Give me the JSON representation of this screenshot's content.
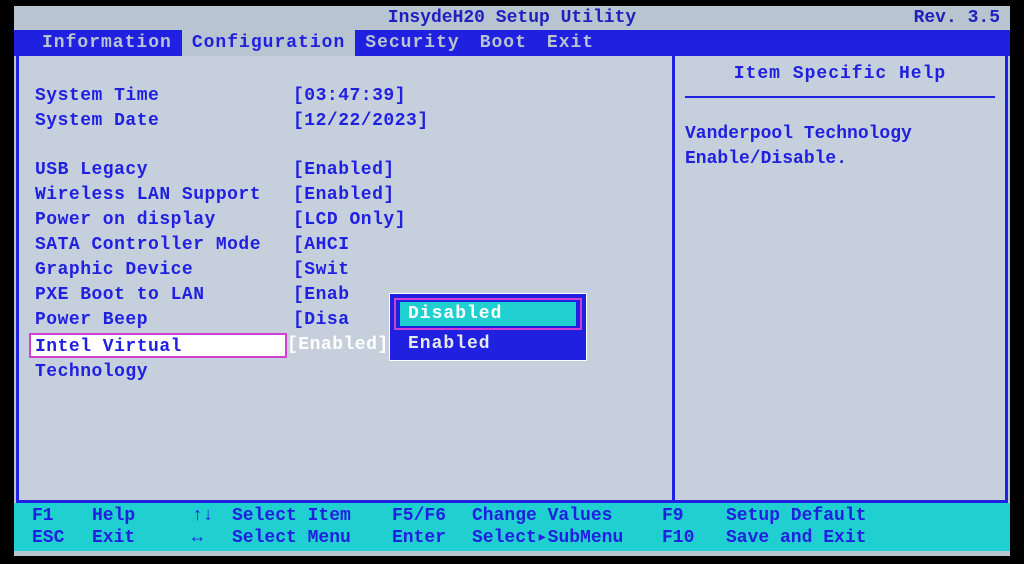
{
  "title": "InsydeH20 Setup Utility",
  "revision": "Rev. 3.5",
  "menu": {
    "items": [
      "Information",
      "Configuration",
      "Security",
      "Boot",
      "Exit"
    ],
    "active_index": 1
  },
  "settings": [
    {
      "label": "System Time",
      "value": "[03:47:39]"
    },
    {
      "label": "System Date",
      "value": "[12/22/2023]"
    }
  ],
  "settings2": [
    {
      "label": "USB Legacy",
      "value": "[Enabled]"
    },
    {
      "label": "Wireless LAN Support",
      "value": "[Enabled]"
    },
    {
      "label": "Power on display",
      "value": "[LCD Only]"
    },
    {
      "label": "SATA Controller Mode",
      "value": "[AHCI"
    },
    {
      "label": "Graphic Device",
      "value": "[Swit"
    },
    {
      "label": "PXE Boot to LAN",
      "value": "[Enab"
    },
    {
      "label": "Power Beep",
      "value": "[Disa"
    },
    {
      "label": "Intel Virtual Technology",
      "value": "[Enabled]",
      "selected": true
    }
  ],
  "popup": {
    "options": [
      "Disabled",
      "Enabled"
    ],
    "selected_index": 0
  },
  "help": {
    "title": "Item Specific Help",
    "text": "Vanderpool Technology Enable/Disable."
  },
  "footer": {
    "row1": [
      {
        "key": "F1",
        "label": "Help",
        "arrow": "↑↓",
        "desc": "Select Item"
      },
      {
        "key": "F5/F6",
        "desc": "Change Values"
      },
      {
        "key": "F9",
        "desc": "Setup Default"
      }
    ],
    "row2": [
      {
        "key": "ESC",
        "label": "Exit",
        "arrow": "↔",
        "desc": "Select Menu"
      },
      {
        "key": "Enter",
        "desc": "Select▸SubMenu"
      },
      {
        "key": "F10",
        "desc": "Save and Exit"
      }
    ]
  }
}
